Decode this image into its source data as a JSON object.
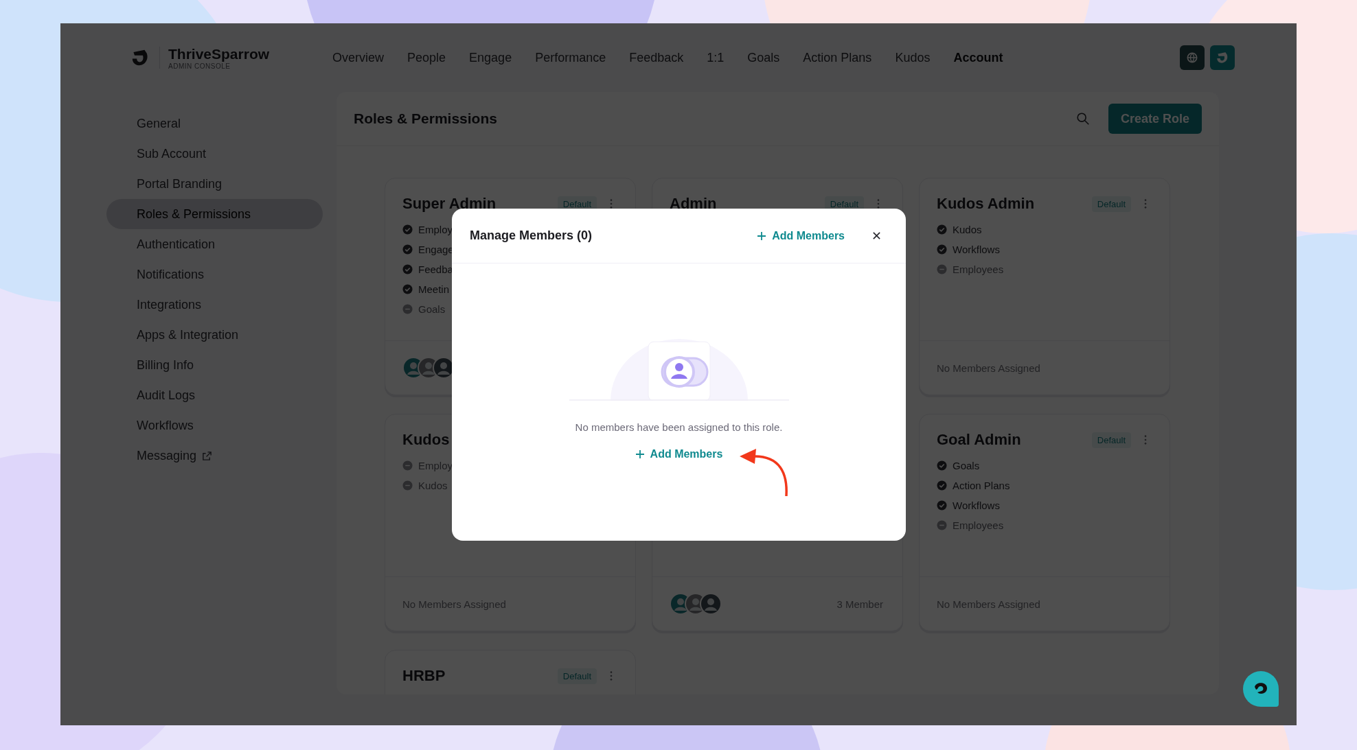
{
  "brand": {
    "name": "ThriveSparrow",
    "subtitle": "ADMIN CONSOLE"
  },
  "nav": [
    {
      "label": "Overview",
      "selected": false
    },
    {
      "label": "People",
      "selected": false
    },
    {
      "label": "Engage",
      "selected": false
    },
    {
      "label": "Performance",
      "selected": false
    },
    {
      "label": "Feedback",
      "selected": false
    },
    {
      "label": "1:1",
      "selected": false
    },
    {
      "label": "Goals",
      "selected": false
    },
    {
      "label": "Action Plans",
      "selected": false
    },
    {
      "label": "Kudos",
      "selected": false
    },
    {
      "label": "Account",
      "selected": true
    }
  ],
  "sidebar": {
    "items": [
      {
        "label": "General",
        "selected": false,
        "external": false
      },
      {
        "label": "Sub Account",
        "selected": false,
        "external": false
      },
      {
        "label": "Portal Branding",
        "selected": false,
        "external": false
      },
      {
        "label": "Roles & Permissions",
        "selected": true,
        "external": false
      },
      {
        "label": "Authentication",
        "selected": false,
        "external": false
      },
      {
        "label": "Notifications",
        "selected": false,
        "external": false
      },
      {
        "label": "Integrations",
        "selected": false,
        "external": false
      },
      {
        "label": "Apps & Integration",
        "selected": false,
        "external": false
      },
      {
        "label": "Billing Info",
        "selected": false,
        "external": false
      },
      {
        "label": "Audit Logs",
        "selected": false,
        "external": false
      },
      {
        "label": "Workflows",
        "selected": false,
        "external": false
      },
      {
        "label": "Messaging",
        "selected": false,
        "external": true
      }
    ]
  },
  "panel": {
    "title": "Roles & Permissions",
    "button": "Create Role"
  },
  "cards": [
    {
      "title": "Super Admin",
      "badge": "Default",
      "permissions": [
        {
          "label": "Employ",
          "enabled": true
        },
        {
          "label": "Engage",
          "enabled": true
        },
        {
          "label": "Feedba",
          "enabled": true
        },
        {
          "label": "Meetin",
          "enabled": true
        },
        {
          "label": "Goals",
          "enabled": false
        }
      ],
      "avatars": [
        {
          "kind": "photo"
        },
        {
          "kind": "photo"
        },
        {
          "kind": "photo"
        }
      ]
    },
    {
      "title": "Admin",
      "badge": "Default"
    },
    {
      "title": "Kudos Admin",
      "badge": "Default",
      "permissions": [
        {
          "label": "Kudos",
          "enabled": true
        },
        {
          "label": "Workflows",
          "enabled": true
        },
        {
          "label": "Employees",
          "enabled": false
        }
      ],
      "footer_text": "No Members Assigned"
    },
    {
      "title": "Kudos",
      "permissions": [
        {
          "label": "Employ",
          "enabled": false
        },
        {
          "label": "Kudos",
          "enabled": false
        }
      ],
      "footer_text": "No Members Assigned"
    },
    {
      "avatars": [
        {
          "kind": "photo"
        },
        {
          "kind": "photo"
        },
        {
          "kind": "photo"
        }
      ],
      "footer_text": "3 Member"
    },
    {
      "title": "Goal Admin",
      "badge": "Default",
      "permissions": [
        {
          "label": "Goals",
          "enabled": true
        },
        {
          "label": "Action Plans",
          "enabled": true
        },
        {
          "label": "Workflows",
          "enabled": true
        },
        {
          "label": "Employees",
          "enabled": false
        }
      ],
      "footer_text": "No Members Assigned"
    },
    {
      "title": "HRBP",
      "badge": "Default"
    }
  ],
  "modal": {
    "title": "Manage Members (0)",
    "header_action": "Add Members",
    "empty_message": "No members have been assigned to this role.",
    "action": "Add Members"
  }
}
